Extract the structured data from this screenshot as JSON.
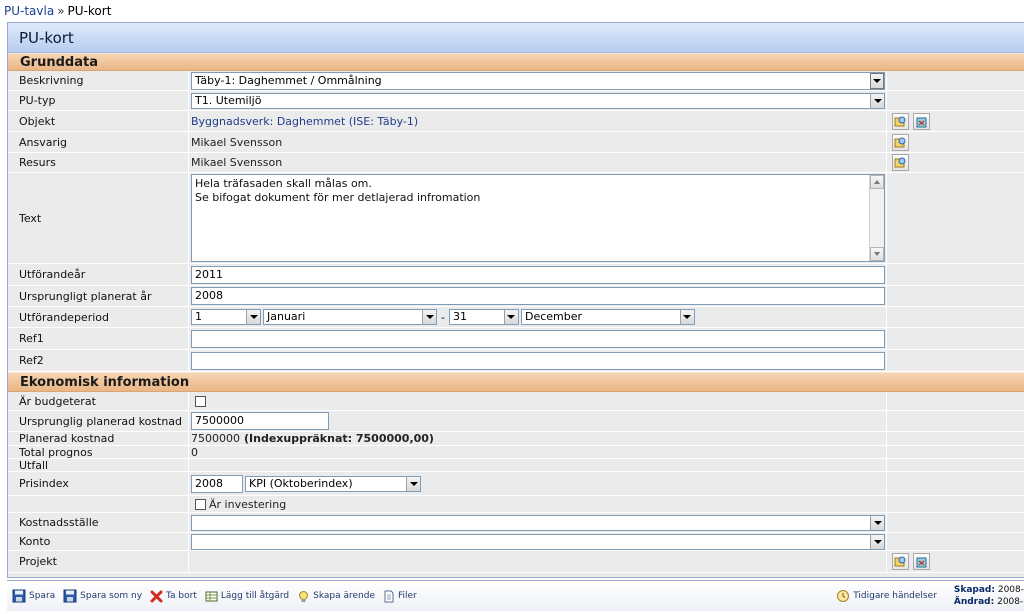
{
  "breadcrumb": {
    "parent": "PU-tavla",
    "separator": "»",
    "current": "PU-kort"
  },
  "card_title": "PU-kort",
  "sections": {
    "grunddata": "Grunddata",
    "ekonomi": "Ekonomisk information"
  },
  "fields": {
    "beskrivning": {
      "label": "Beskrivning",
      "value": "Täby-1: Daghemmet / Ommålning"
    },
    "pu_typ": {
      "label": "PU-typ",
      "value": "T1. Utemiljö"
    },
    "objekt": {
      "label": "Objekt",
      "value": "Byggnadsverk: Daghemmet (ISE: Täby-1)"
    },
    "ansvarig": {
      "label": "Ansvarig",
      "value": "Mikael Svensson"
    },
    "resurs": {
      "label": "Resurs",
      "value": "Mikael Svensson"
    },
    "text": {
      "label": "Text",
      "line1": "Hela träfasaden skall målas om.",
      "line2": "Se bifogat dokument för mer detlajerad infromation"
    },
    "utforandear": {
      "label": "Utförandeår",
      "value": "2011"
    },
    "ursprungligt_ar": {
      "label": "Ursprungligt planerat år",
      "value": "2008"
    },
    "utforandeperiod": {
      "label": "Utförandeperiod",
      "start_day": "1",
      "start_month": "Januari",
      "dash": "-",
      "end_day": "31",
      "end_month": "December"
    },
    "ref1": {
      "label": "Ref1",
      "value": ""
    },
    "ref2": {
      "label": "Ref2",
      "value": ""
    },
    "ar_budgeterat": {
      "label": "Är budgeterat",
      "checked": false
    },
    "ursprunglig_kostnad": {
      "label": "Ursprunglig planerad kostnad",
      "value": "7500000"
    },
    "planerad_kostnad": {
      "label": "Planerad kostnad",
      "value": "7500000",
      "index_text": "(Indexuppräknat: 7500000,00)"
    },
    "total_prognos": {
      "label": "Total prognos",
      "value": "0"
    },
    "utfall": {
      "label": "Utfall",
      "value": ""
    },
    "prisindex": {
      "label": "Prisindex",
      "year": "2008",
      "index": "KPI (Oktoberindex)"
    },
    "ar_investering": {
      "label": "Är investering",
      "checked": false
    },
    "kostnadsstalle": {
      "label": "Kostnadsställe",
      "value": ""
    },
    "konto": {
      "label": "Konto",
      "value": ""
    },
    "projekt": {
      "label": "Projekt",
      "value": ""
    }
  },
  "toolbar": {
    "spara": "Spara",
    "spara_som_ny": "Spara som ny",
    "ta_bort": "Ta bort",
    "lagg_till_atgard": "Lägg till åtgärd",
    "skapa_arende": "Skapa ärende",
    "filer": "Filer",
    "tidigare_handelser": "Tidigare händelser",
    "skapad_label": "Skapad:",
    "skapad_value": "2008-",
    "andrad_label": "Ändrad:",
    "andrad_value": "2008-"
  },
  "colors": {
    "section_bg": "#eab585",
    "title_bg": "#b8cdf0",
    "link": "#213d8a"
  }
}
